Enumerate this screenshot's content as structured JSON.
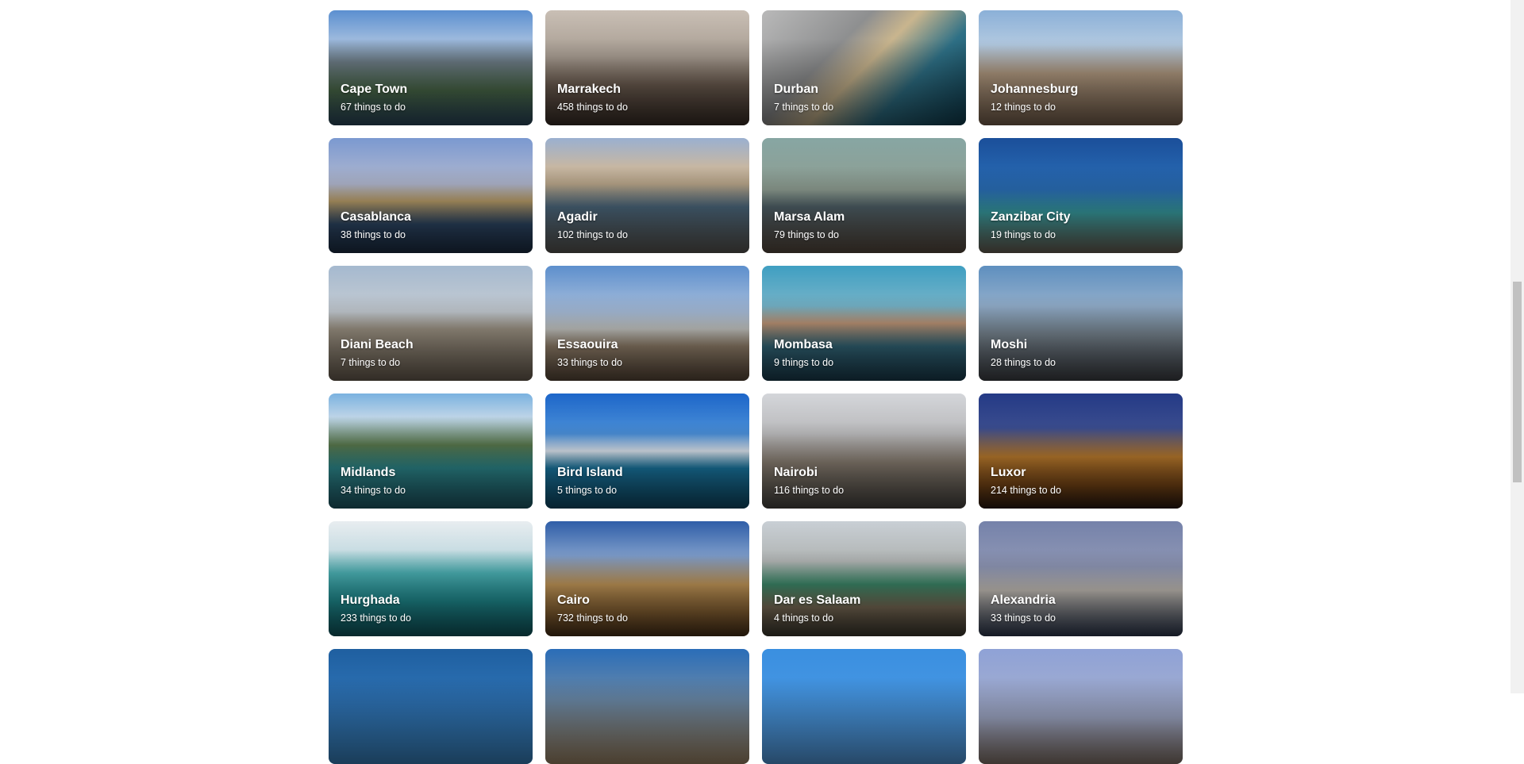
{
  "destinations": [
    {
      "name": "Cape Town",
      "count": "67 things to do",
      "bg": "linear-gradient(to bottom,#5b8fd0 0%,#9cb9dd 25%,#6d7c86 45%,#4b6b4a 70%,#2c4a60 100%)"
    },
    {
      "name": "Marrakech",
      "count": "458 things to do",
      "bg": "linear-gradient(to bottom,#c9bfb5 0%,#a89d92 40%,#6f5f52 65%,#3a2e27 100%)"
    },
    {
      "name": "Durban",
      "count": "7 things to do",
      "bg": "linear-gradient(135deg,#b9b9b9 0%,#8e8f90 35%,#c9b58e 50%,#2e7086 70%,#0f3c4e 100%)"
    },
    {
      "name": "Johannesburg",
      "count": "12 things to do",
      "bg": "linear-gradient(to bottom,#8bb0d8 0%,#b2c9e0 30%,#b49c82 55%,#7b6450 100%)"
    },
    {
      "name": "Casablanca",
      "count": "38 things to do",
      "bg": "linear-gradient(to bottom,#7b99d0 0%,#b1b8cf 40%,#bfa26c 55%,#2f4a6a 75%,#1d2f46 100%)"
    },
    {
      "name": "Agadir",
      "count": "102 things to do",
      "bg": "linear-gradient(to bottom,#9ab0d0 0%,#c7b7a3 25%,#b9a68a 40%,#4d6a80 60%,#5d5a55 100%)"
    },
    {
      "name": "Marsa Alam",
      "count": "79 things to do",
      "bg": "linear-gradient(to bottom,#87a6a3 0%,#8f9e92 45%,#52646c 60%,#5a4c40 100%)"
    },
    {
      "name": "Zanzibar City",
      "count": "19 things to do",
      "bg": "linear-gradient(to bottom,#1b4f9a 0%,#2a6fb8 45%,#3aa3a6 65%,#6e6457 100%)"
    },
    {
      "name": "Diani Beach",
      "count": "7 things to do",
      "bg": "linear-gradient(to bottom,#a5b9cf 0%,#c5ccd3 40%,#a49a8a 55%,#6e6254 100%)"
    },
    {
      "name": "Essaouira",
      "count": "33 things to do",
      "bg": "linear-gradient(to bottom,#5d8fcd 0%,#a9bfdc 40%,#cfd0cc 55%,#9a8771 70%,#5c4b3b 100%)"
    },
    {
      "name": "Mombasa",
      "count": "9 things to do",
      "bg": "linear-gradient(to bottom,#3f9fc2 0%,#75b3c8 35%,#c59a7a 50%,#356b7e 70%,#1b3e50 100%)"
    },
    {
      "name": "Moshi",
      "count": "28 things to do",
      "bg": "linear-gradient(to bottom,#5e8fbf 0%,#92aecb 35%,#7d8b96 60%,#3f4146 100%)"
    },
    {
      "name": "Midlands",
      "count": "34 things to do",
      "bg": "linear-gradient(to bottom,#7ab2e0 0%,#bcd3e7 20%,#5a7a4e 45%,#2d8a8e 65%,#1f5c6a 100%)"
    },
    {
      "name": "Bird Island",
      "count": "5 things to do",
      "bg": "linear-gradient(to bottom,#1d66c9 0%,#4a8fd8 35%,#e4edf7 50%,#1a7aa6 65%,#0f4d6a 100%)"
    },
    {
      "name": "Nairobi",
      "count": "116 things to do",
      "bg": "linear-gradient(to bottom,#d4d6da 0%,#b9b9bb 35%,#8d8275 60%,#4a4742 100%)"
    },
    {
      "name": "Luxor",
      "count": "214 things to do",
      "bg": "linear-gradient(to bottom,#243a86 0%,#3a4c8e 30%,#c17f2e 55%,#7a4716 80%,#2b1a10 100%)"
    },
    {
      "name": "Hurghada",
      "count": "233 things to do",
      "bg": "linear-gradient(to bottom,#e8edf0 0%,#c9dde3 25%,#4cb3b6 45%,#1f8e92 70%,#0f5a62 100%)"
    },
    {
      "name": "Cairo",
      "count": "732 things to do",
      "bg": "linear-gradient(to bottom,#2f5ea8 0%,#7c9bc9 30%,#c69a5a 55%,#8b6434 80%,#4a3218 100%)"
    },
    {
      "name": "Dar es Salaam",
      "count": "4 things to do",
      "bg": "linear-gradient(to bottom,#c9cfd5 0%,#b0b4b3 35%,#3c8a6a 55%,#7d6e58 75%,#3e3a30 100%)"
    },
    {
      "name": "Alexandria",
      "count": "33 things to do",
      "bg": "linear-gradient(to bottom,#7582aa 0%,#8f97b5 40%,#c9c3bb 60%,#2f3b52 100%)"
    },
    {
      "name": "",
      "count": "",
      "bg": "linear-gradient(to bottom,#1f5fa0 0%,#2f75b8 50%,#3a86c4 100%)"
    },
    {
      "name": "",
      "count": "",
      "bg": "linear-gradient(to bottom,#2a6db8 0%,#6c8aa8 45%,#a48b6a 100%)"
    },
    {
      "name": "",
      "count": "",
      "bg": "linear-gradient(to bottom,#3a8fe0 0%,#55a0e6 100%)"
    },
    {
      "name": "",
      "count": "",
      "bg": "linear-gradient(to bottom,#8fa2d6 0%,#a7b0cf 60%,#8a7a70 100%)"
    }
  ]
}
